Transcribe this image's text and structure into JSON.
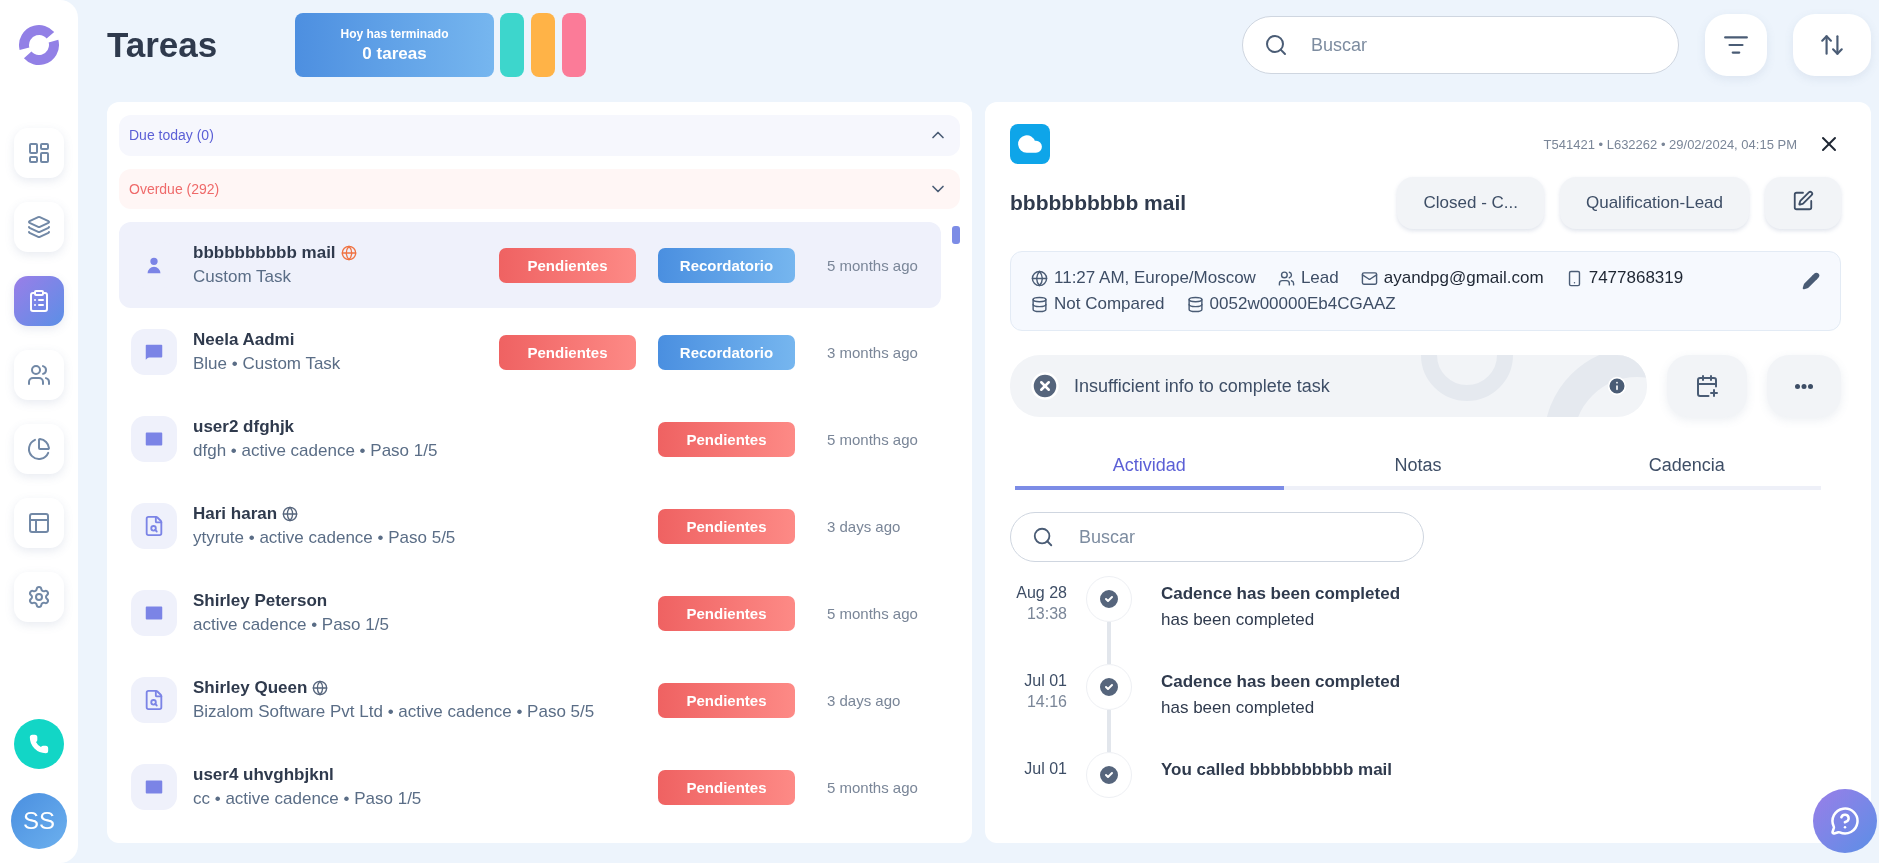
{
  "sidebar": {
    "items": [
      {
        "kind": "dashboard",
        "selected": false
      },
      {
        "kind": "layers",
        "selected": false
      },
      {
        "kind": "tasks",
        "selected": true
      },
      {
        "kind": "people",
        "selected": false
      },
      {
        "kind": "chart",
        "selected": false
      },
      {
        "kind": "layout",
        "selected": false
      },
      {
        "kind": "settings",
        "selected": false
      }
    ],
    "avatar": "SS"
  },
  "header": {
    "title": "Tareas",
    "summary": {
      "caption": "Hoy has terminado",
      "value": "0 tareas"
    },
    "pills": [
      {
        "color": "#3dd6cc"
      },
      {
        "color": "#ffb347"
      },
      {
        "color": "#fb7b98"
      }
    ],
    "search": {
      "placeholder": "Buscar"
    }
  },
  "sections": [
    {
      "label": "Due today (0)",
      "kind": "today",
      "expanded": true
    },
    {
      "label": "Overdue (292)",
      "kind": "overdue",
      "expanded": false
    }
  ],
  "tasks": [
    {
      "name": "bbbbbbbbbb mail",
      "kind": "contact",
      "zone": {
        "color": "#f07241"
      },
      "subtitle": "Custom Task",
      "selected": true,
      "badges": [
        {
          "label": "Pendientes",
          "kind": "pending"
        },
        {
          "label": "Recordatorio",
          "kind": "reminder"
        }
      ],
      "time": "5 months ago"
    },
    {
      "name": "Neela Aadmi",
      "kind": "chat",
      "subtitle": "Blue • Custom Task",
      "selected": false,
      "badges": [
        {
          "label": "Pendientes",
          "kind": "pending"
        },
        {
          "label": "Recordatorio",
          "kind": "reminder"
        }
      ],
      "time": "3 months ago"
    },
    {
      "name": "user2 dfghjk",
      "kind": "mail",
      "subtitle": "dfgh • active cadence • Paso 1/5",
      "selected": false,
      "badges": [
        {
          "label": "Pendientes",
          "kind": "pending"
        }
      ],
      "time": "5 months ago"
    },
    {
      "name": "Hari haran",
      "kind": "lookup",
      "zone": {
        "color": "#56657c"
      },
      "subtitle": "ytyrute • active cadence • Paso 5/5",
      "selected": false,
      "badges": [
        {
          "label": "Pendientes",
          "kind": "pending"
        }
      ],
      "time": "3 days ago"
    },
    {
      "name": "Shirley Peterson",
      "kind": "mail",
      "subtitle": "active cadence • Paso 1/5",
      "selected": false,
      "badges": [
        {
          "label": "Pendientes",
          "kind": "pending"
        }
      ],
      "time": "5 months ago"
    },
    {
      "name": "Shirley Queen",
      "kind": "lookup",
      "zone": {
        "color": "#56657c"
      },
      "subtitle": "Bizalom Software Pvt Ltd • active cadence • Paso 5/5",
      "selected": false,
      "badges": [
        {
          "label": "Pendientes",
          "kind": "pending"
        }
      ],
      "time": "3 days ago"
    },
    {
      "name": "user4 uhvghbjknl",
      "kind": "mail",
      "subtitle": "cc • active cadence • Paso 1/5",
      "selected": false,
      "badges": [
        {
          "label": "Pendientes",
          "kind": "pending"
        }
      ],
      "time": "5 months ago"
    }
  ],
  "detail": {
    "meta": "T541421 • L632262 • 29/02/2024, 04:15 PM",
    "title": "bbbbbbbbbb mail",
    "chips": [
      "Closed - C...",
      "Qualification-Lead"
    ],
    "info": [
      {
        "kind": "timezone",
        "text": "11:27 AM, Europe/Moscow"
      },
      {
        "kind": "role",
        "text": "Lead"
      },
      {
        "kind": "email",
        "text": "ayandpg@gmail.com"
      },
      {
        "kind": "phone",
        "text": "7477868319"
      },
      {
        "kind": "status",
        "text": "Not Compared"
      },
      {
        "kind": "id",
        "text": "0052w00000Eb4CGAAZ"
      }
    ],
    "notice": "Insufficient info to complete task",
    "tabs": [
      {
        "label": "Actividad",
        "selected": true
      },
      {
        "label": "Notas",
        "selected": false
      },
      {
        "label": "Cadencia",
        "selected": false
      }
    ],
    "search": {
      "placeholder": "Buscar"
    },
    "activity": [
      {
        "date": "Aug 28",
        "time": "13:38",
        "title": "Cadence has been completed",
        "text": "has been completed"
      },
      {
        "date": "Jul 01",
        "time": "14:16",
        "title": "Cadence has been completed",
        "text": "has been completed"
      },
      {
        "date": "Jul 01",
        "title": "You called bbbbbbbbbb mail"
      }
    ]
  }
}
